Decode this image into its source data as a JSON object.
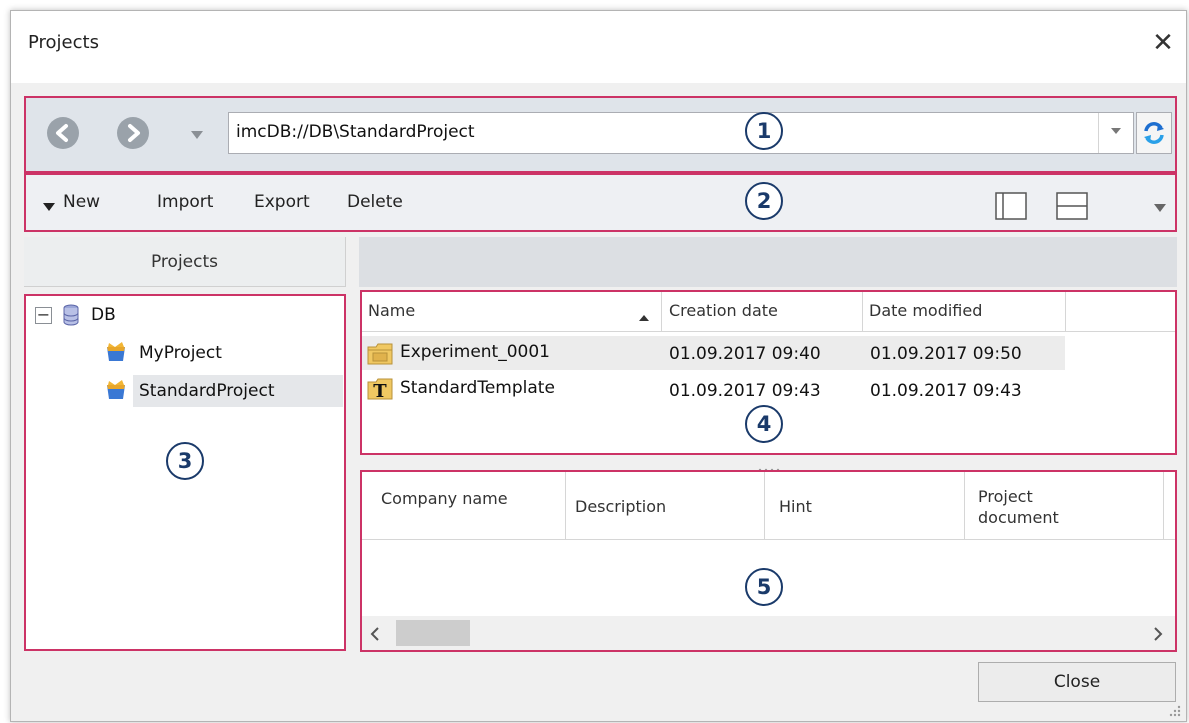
{
  "window": {
    "title": "Projects",
    "close_glyph": "✕"
  },
  "nav": {
    "back_icon": "back-arrow-icon",
    "forward_icon": "forward-arrow-icon",
    "address": "imcDB://DB\\StandardProject",
    "marker": "1"
  },
  "toolbar": {
    "new_label": "New",
    "import_label": "Import",
    "export_label": "Export",
    "delete_label": "Delete",
    "marker": "2"
  },
  "tree": {
    "header": "Projects",
    "root_label": "DB",
    "toggle_glyph": "−",
    "items": [
      {
        "label": "MyProject"
      },
      {
        "label": "StandardProject"
      }
    ],
    "marker": "3"
  },
  "list": {
    "columns": [
      "Name",
      "Creation date",
      "Date modified"
    ],
    "rows": [
      {
        "name": "Experiment_0001",
        "created": "01.09.2017 09:40",
        "modified": "01.09.2017 09:50"
      },
      {
        "name": "StandardTemplate",
        "created": "01.09.2017 09:43",
        "modified": "01.09.2017 09:43"
      }
    ],
    "marker": "4"
  },
  "properties": {
    "columns": [
      "Company name",
      "Description",
      "Hint",
      "Project document"
    ],
    "marker": "5"
  },
  "footer": {
    "close_label": "Close"
  },
  "colors": {
    "highlight": "#cc3366",
    "marker": "#1a3a6a"
  }
}
